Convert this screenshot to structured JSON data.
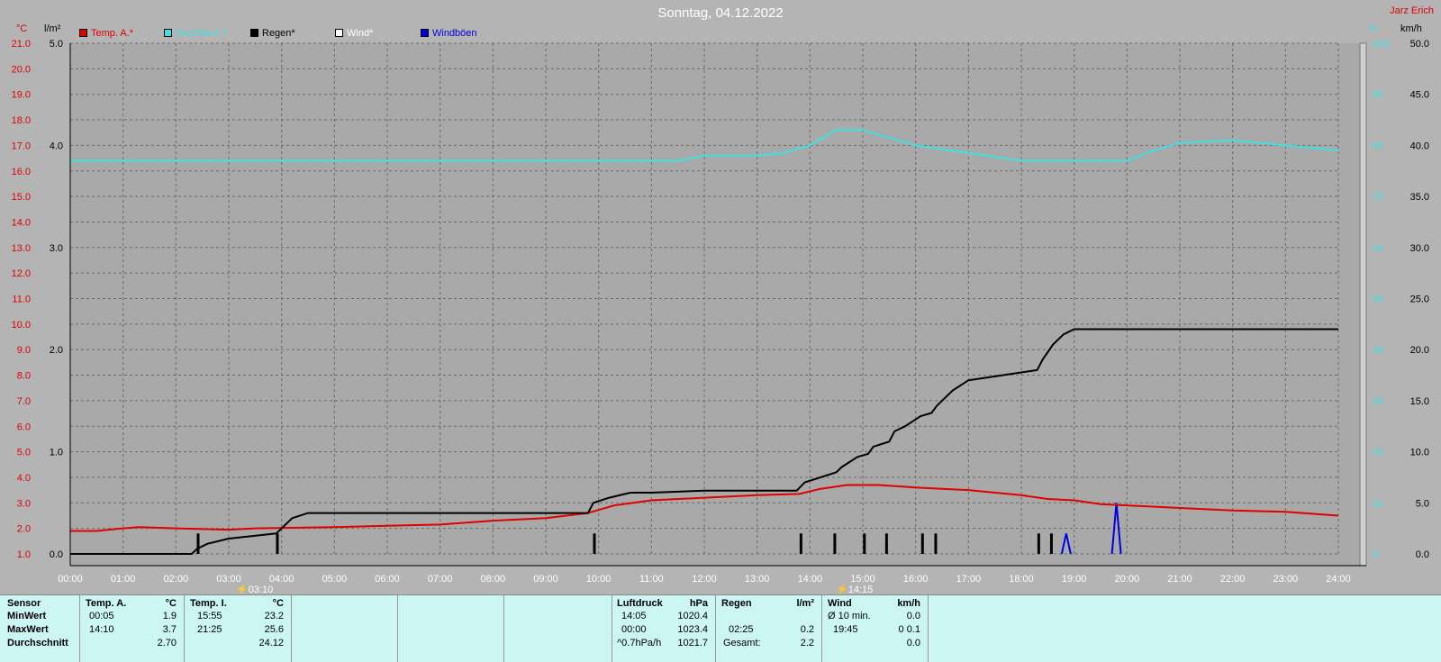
{
  "title": "Sonntag, 04.12.2022",
  "author": "Jarz Erich",
  "units": {
    "left_temp": "°C",
    "left_rain": "l/m²",
    "right_hum": "%",
    "right_wind": "km/h"
  },
  "legend": [
    {
      "label": "Temp. A.*",
      "color": "#e00000"
    },
    {
      "label": "Feuchte A.*",
      "color": "#40e0e0"
    },
    {
      "label": "Regen*",
      "color": "#000000"
    },
    {
      "label": "Wind*",
      "color": "#ffffff"
    },
    {
      "label": "Windböen",
      "color": "#0000e0"
    }
  ],
  "time_markers": [
    {
      "label": "03:10",
      "time": 3.1667
    },
    {
      "label": "14:15",
      "time": 14.25
    }
  ],
  "chart_data": {
    "type": "line",
    "title": "Sonntag, 04.12.2022",
    "x_ticks": [
      "00:00",
      "01:00",
      "02:00",
      "03:00",
      "04:00",
      "05:00",
      "06:00",
      "07:00",
      "08:00",
      "09:00",
      "10:00",
      "11:00",
      "12:00",
      "13:00",
      "14:00",
      "15:00",
      "16:00",
      "17:00",
      "18:00",
      "19:00",
      "20:00",
      "21:00",
      "22:00",
      "23:00",
      "24:00"
    ],
    "xlim": [
      0,
      24
    ],
    "axes": {
      "temp": {
        "ylim": [
          1.0,
          21.0
        ],
        "ticks": [
          "1.0",
          "2.0",
          "3.0",
          "4.0",
          "5.0",
          "6.0",
          "7.0",
          "8.0",
          "9.0",
          "10.0",
          "11.0",
          "12.0",
          "13.0",
          "14.0",
          "15.0",
          "16.0",
          "17.0",
          "18.0",
          "19.0",
          "20.0",
          "21.0"
        ]
      },
      "rain": {
        "ylim": [
          0.0,
          5.0
        ],
        "ticks": [
          "0.0",
          "1.0",
          "2.0",
          "3.0",
          "4.0",
          "5.0"
        ]
      },
      "humidity": {
        "ylim": [
          0,
          100
        ],
        "ticks": [
          "0",
          "10",
          "20",
          "30",
          "40",
          "50",
          "60",
          "70",
          "80",
          "90",
          "100"
        ]
      },
      "wind": {
        "ylim": [
          0.0,
          50.0
        ],
        "ticks": [
          "0.0",
          "5.0",
          "10.0",
          "15.0",
          "20.0",
          "25.0",
          "30.0",
          "35.0",
          "40.0",
          "45.0",
          "50.0"
        ]
      }
    },
    "grid": true,
    "series": [
      {
        "name": "Temp. A.*",
        "axis": "temp",
        "color": "#e00000",
        "x": [
          0,
          0.5,
          1,
          1.3,
          2,
          3,
          3.5,
          5,
          6,
          7,
          8,
          9,
          9.8,
          10.3,
          11,
          12,
          13,
          13.8,
          14.2,
          14.7,
          15.3,
          16,
          16.5,
          17,
          17.5,
          18,
          18.5,
          19,
          19.5,
          20,
          21,
          22,
          23,
          24
        ],
        "y": [
          1.9,
          1.9,
          2.0,
          2.05,
          2.0,
          1.95,
          2.0,
          2.05,
          2.1,
          2.15,
          2.3,
          2.4,
          2.6,
          2.9,
          3.1,
          3.2,
          3.3,
          3.35,
          3.55,
          3.7,
          3.7,
          3.6,
          3.55,
          3.5,
          3.4,
          3.3,
          3.15,
          3.1,
          2.95,
          2.9,
          2.8,
          2.7,
          2.65,
          2.5
        ]
      },
      {
        "name": "Feuchte A.*",
        "axis": "humidity",
        "color": "#40e0e0",
        "x": [
          0,
          2,
          4,
          6,
          8,
          10,
          11.5,
          12,
          13,
          13.5,
          14,
          14.5,
          15,
          15.5,
          16,
          17,
          18,
          19,
          20,
          20.5,
          21,
          22,
          23,
          24
        ],
        "y": [
          77,
          77,
          77,
          77,
          77,
          77,
          77,
          78,
          78,
          78.5,
          80,
          83,
          83,
          81.5,
          80,
          78.5,
          77,
          77,
          77,
          79,
          80.5,
          81,
          80,
          79
        ]
      },
      {
        "name": "Regen*",
        "axis": "rain",
        "color": "#000000",
        "x": [
          0,
          2.3,
          2.4,
          2.6,
          3.0,
          3.9,
          4.0,
          4.2,
          4.5,
          5.0,
          9.8,
          9.9,
          10.2,
          10.6,
          11,
          12,
          13,
          13.75,
          13.9,
          14.2,
          14.5,
          14.6,
          14.9,
          15.1,
          15.2,
          15.5,
          15.6,
          15.8,
          16.1,
          16.3,
          16.4,
          16.7,
          17,
          18.3,
          18.4,
          18.6,
          18.8,
          19.0,
          19.5,
          24
        ],
        "y": [
          0,
          0,
          0.05,
          0.1,
          0.15,
          0.2,
          0.25,
          0.35,
          0.4,
          0.4,
          0.4,
          0.5,
          0.55,
          0.6,
          0.6,
          0.62,
          0.62,
          0.62,
          0.7,
          0.75,
          0.8,
          0.85,
          0.95,
          0.98,
          1.05,
          1.1,
          1.2,
          1.25,
          1.35,
          1.38,
          1.45,
          1.6,
          1.7,
          1.8,
          1.9,
          2.05,
          2.15,
          2.2,
          2.2,
          2.2
        ]
      }
    ],
    "rain_bars": {
      "x": [
        2.42,
        3.92,
        9.92,
        13.83,
        14.47,
        15.03,
        15.45,
        16.13,
        16.38,
        18.33,
        18.57
      ],
      "value": 0.2
    },
    "windboeen": [
      {
        "time": 18.85,
        "value": 2.0
      },
      {
        "time": 19.8,
        "value": 5.0
      }
    ]
  },
  "table": {
    "sensor_col": {
      "header": "Sensor",
      "rows": [
        "MinWert",
        "MaxWert",
        "Durchschnitt"
      ]
    },
    "temp_a": {
      "header": "Temp. A.",
      "unit": "°C",
      "rows": [
        [
          "00:05",
          "1.9"
        ],
        [
          "14:10",
          "3.7"
        ],
        [
          "",
          "2.70"
        ]
      ]
    },
    "temp_i": {
      "header": "Temp. I.",
      "unit": "°C",
      "rows": [
        [
          "15:55",
          "23.2"
        ],
        [
          "21:25",
          "25.6"
        ],
        [
          "",
          "24.12"
        ]
      ]
    },
    "luftdruck": {
      "header": "Luftdruck",
      "unit": "hPa",
      "rows": [
        [
          "14:05",
          "1020.4"
        ],
        [
          "00:00",
          "1023.4"
        ],
        [
          "^0.7hPa/h",
          "1021.7"
        ]
      ]
    },
    "regen": {
      "header": "Regen",
      "unit": "l/m²",
      "rows": [
        [
          "",
          ""
        ],
        [
          "02:25",
          "0.2"
        ],
        [
          "Gesamt:",
          "2.2"
        ]
      ]
    },
    "wind": {
      "header": "Wind",
      "unit": "km/h",
      "rows": [
        [
          "Ø 10 min.",
          "0.0"
        ],
        [
          "19:45",
          "0 0.1"
        ],
        [
          "",
          "0.0"
        ]
      ]
    }
  }
}
